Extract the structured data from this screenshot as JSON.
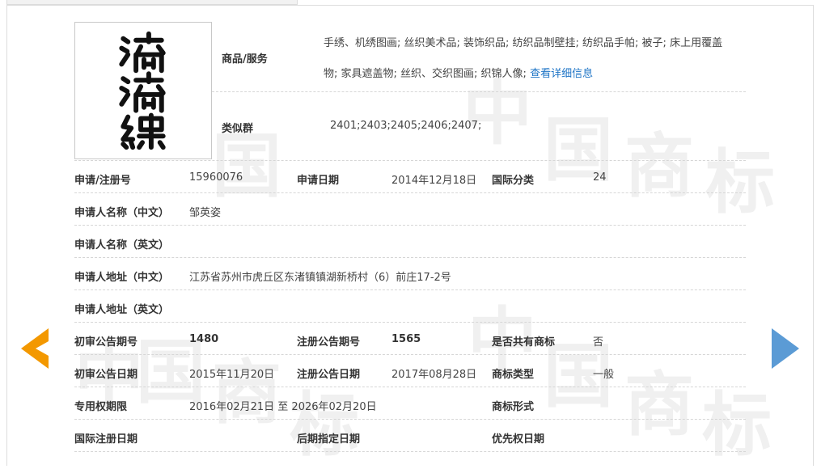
{
  "logo": {
    "alt_text": "滴滴绣"
  },
  "goods": {
    "label": "商品/服务",
    "line1": "手绣、机绣图画; 丝织美术品; 装饰织品; 纺织品制壁挂; 纺织品手帕; 被子; 床上用覆盖",
    "line2_text": "物; 家具遮盖物; 丝织、交织图画; 织锦人像;",
    "detail_link": "查看详细信息"
  },
  "similar_group": {
    "label": "类似群",
    "value": "2401;2403;2405;2406;2407;"
  },
  "fields": {
    "reg_no": {
      "label": "申请/注册号",
      "value": "15960076"
    },
    "apply_date": {
      "label": "申请日期",
      "value": "2014年12月18日"
    },
    "intl_class": {
      "label": "国际分类",
      "value": "24"
    },
    "applicant_cn": {
      "label": "申请人名称（中文）",
      "value": "邹英姿"
    },
    "applicant_en": {
      "label": "申请人名称（英文）",
      "value": ""
    },
    "address_cn": {
      "label": "申请人地址（中文）",
      "value": "江苏省苏州市虎丘区东渚镇镇湖新桥村（6）前庄17-2号"
    },
    "address_en": {
      "label": "申请人地址（英文）",
      "value": ""
    },
    "prelim_no": {
      "label": "初审公告期号",
      "value": "1480"
    },
    "reg_pub_no": {
      "label": "注册公告期号",
      "value": "1565"
    },
    "shared": {
      "label": "是否共有商标",
      "value": "否"
    },
    "prelim_date": {
      "label": "初审公告日期",
      "value": "2015年11月20日"
    },
    "reg_pub_date": {
      "label": "注册公告日期",
      "value": "2017年08月28日"
    },
    "mark_type": {
      "label": "商标类型",
      "value": "一般"
    },
    "exclusive_period": {
      "label": "专用权期限",
      "value": "2016年02月21日 至 2026年02月20日"
    },
    "mark_form": {
      "label": "商标形式",
      "value": ""
    },
    "intl_reg_date": {
      "label": "国际注册日期",
      "value": ""
    },
    "later_designation": {
      "label": "后期指定日期",
      "value": ""
    },
    "priority_date": {
      "label": "优先权日期",
      "value": ""
    }
  },
  "watermark": {
    "chars": [
      "中",
      "国",
      "商",
      "标"
    ]
  },
  "colors": {
    "prev_arrow": "#f39800",
    "next_arrow": "#5b9bd5",
    "link": "#1e74c6"
  },
  "icons": {
    "prev": "arrow-left-icon",
    "next": "arrow-right-icon"
  }
}
